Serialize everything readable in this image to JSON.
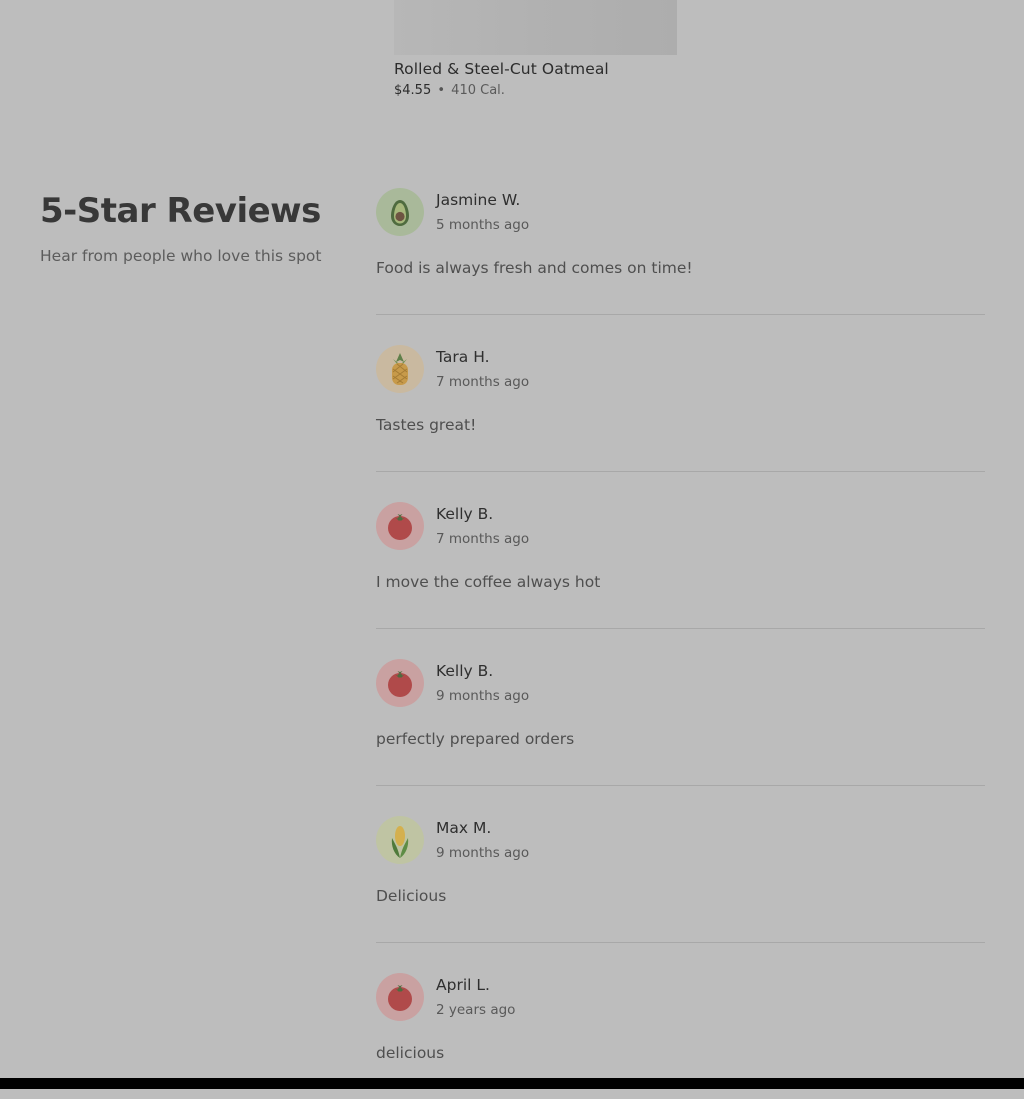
{
  "menu_item": {
    "name": "Rolled & Steel-Cut Oatmeal",
    "price": "$4.55",
    "separator": "•",
    "calories": "410 Cal."
  },
  "reviews_section": {
    "title": "5-Star Reviews",
    "subtitle": "Hear from people who love this spot"
  },
  "reviews": [
    {
      "name": "Jasmine W.",
      "date": "5 months ago",
      "text": "Food is always fresh and comes on time!",
      "avatar": "avocado-icon"
    },
    {
      "name": "Tara H.",
      "date": "7 months ago",
      "text": "Tastes great!",
      "avatar": "pineapple-icon"
    },
    {
      "name": "Kelly B.",
      "date": "7 months ago",
      "text": "I move the coffee always hot",
      "avatar": "tomato-icon"
    },
    {
      "name": "Kelly B.",
      "date": "9 months ago",
      "text": "perfectly prepared orders",
      "avatar": "tomato-icon"
    },
    {
      "name": "Max M.",
      "date": "9 months ago",
      "text": "Delicious",
      "avatar": "corn-icon"
    },
    {
      "name": "April L.",
      "date": "2 years ago",
      "text": "delicious",
      "avatar": "tomato-icon"
    }
  ],
  "colors": {
    "overlay_background": "#bdbdbd",
    "avocado_bg": "#a9b99a",
    "pineapple_bg": "#c9b9a0",
    "tomato_bg": "#c9a1a1",
    "corn_bg": "#bfc4a3"
  }
}
